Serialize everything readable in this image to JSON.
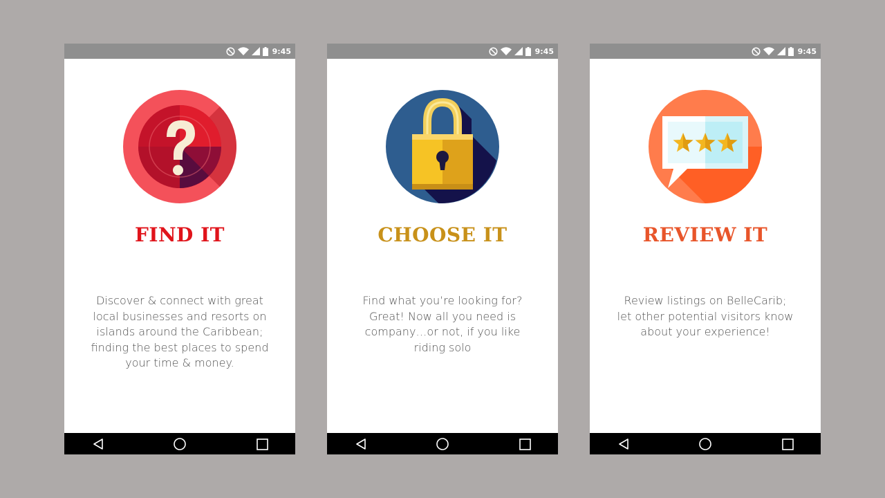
{
  "status_bar": {
    "time": "9:45",
    "icons": [
      "do-not-disturb-icon",
      "wifi-icon",
      "signal-icon",
      "battery-icon"
    ]
  },
  "screens": [
    {
      "title": "FIND IT",
      "title_color": "#e0141b",
      "illustration": "question-mark-icon",
      "description_lines": [
        "Discover & connect with great",
        "local businesses and resorts on",
        "islands around the Caribbean;",
        "finding the best places to spend",
        "your time & money."
      ]
    },
    {
      "title": "CHOOSE IT",
      "title_color": "#c8911a",
      "illustration": "padlock-icon",
      "description_lines": [
        "Find what you’re looking for?",
        "Great! Now all you need is",
        "company…or not, if you like",
        "riding solo"
      ]
    },
    {
      "title": "REVIEW IT",
      "title_color": "#e8552a",
      "illustration": "star-review-icon",
      "description_lines": [
        "Review listings on BelleCarib;",
        "let other potential visitors know",
        "about your experience!"
      ]
    }
  ],
  "nav_bar": {
    "icons": [
      "back-icon",
      "home-icon",
      "recent-apps-icon"
    ]
  },
  "colors": {
    "page_background": "#aeaaa9",
    "status_bar": "#8f8f8f",
    "nav_bar": "#000000",
    "description_text": "#505050"
  }
}
